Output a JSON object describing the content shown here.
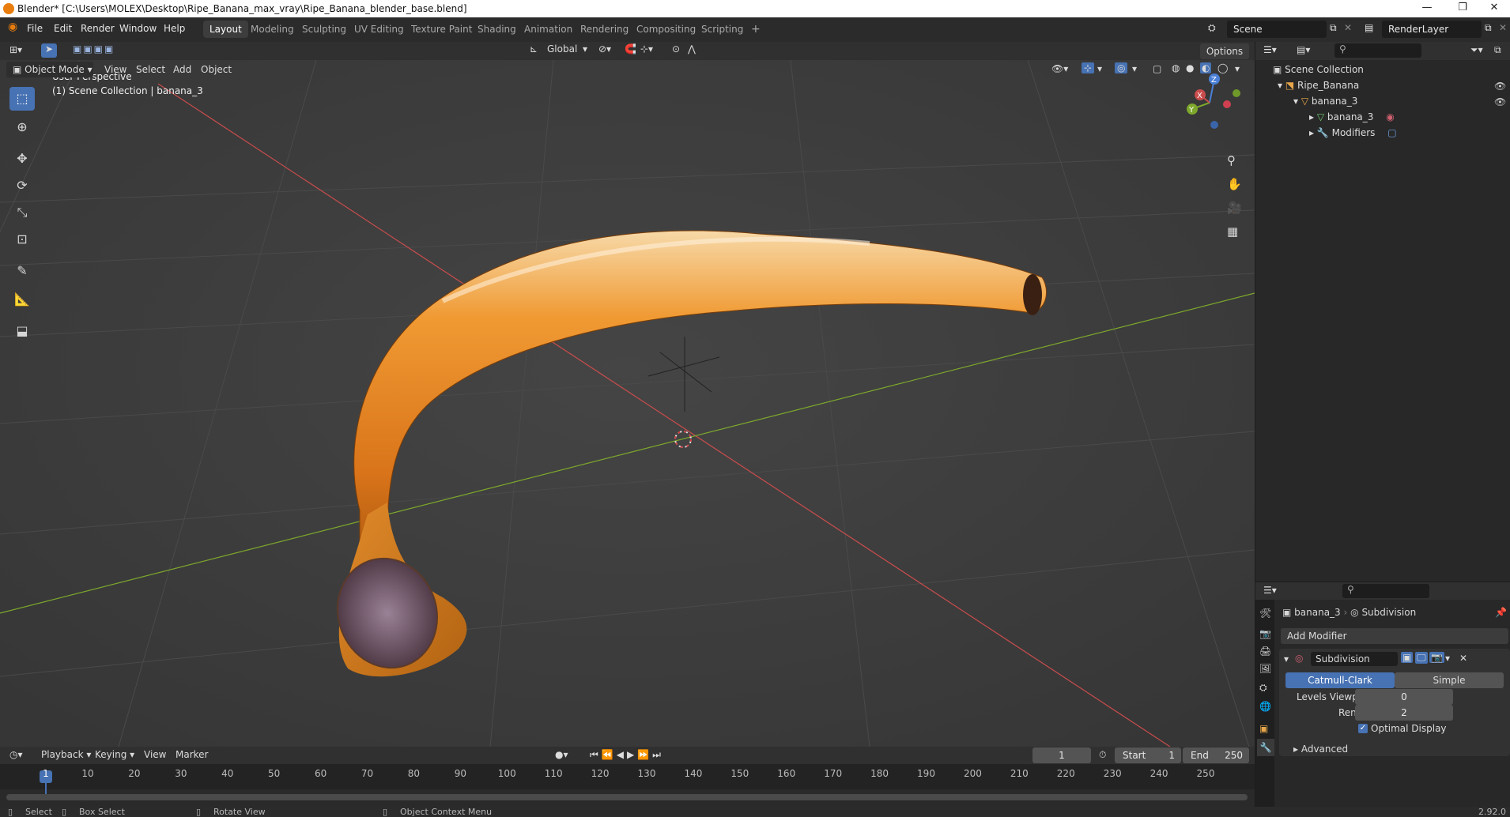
{
  "window": {
    "title": "Blender* [C:\\Users\\MOLEX\\Desktop\\Ripe_Banana_max_vray\\Ripe_Banana_blender_base.blend]",
    "minimize": "—",
    "maximize": "❐",
    "close": "✕"
  },
  "menu": [
    "File",
    "Edit",
    "Render",
    "Window",
    "Help"
  ],
  "workspaces": [
    "Layout",
    "Modeling",
    "Sculpting",
    "UV Editing",
    "Texture Paint",
    "Shading",
    "Animation",
    "Rendering",
    "Compositing",
    "Scripting"
  ],
  "workspace_add": "+",
  "scene": {
    "name": "Scene",
    "render_layer": "RenderLayer"
  },
  "view_header": {
    "transform_orientation": "Global",
    "options": "Options",
    "mode": "Object Mode",
    "menus": [
      "View",
      "Select",
      "Add",
      "Object"
    ]
  },
  "viewport": {
    "perspective": "User Perspective",
    "collection_info": "(1) Scene Collection | banana_3",
    "gizmo_labels": {
      "z": "Z",
      "y": "Y",
      "x": "X"
    }
  },
  "outliner": {
    "root": "Scene Collection",
    "items": [
      {
        "label": "Ripe_Banana",
        "depth": 1,
        "expanded": true
      },
      {
        "label": "banana_3",
        "depth": 2,
        "expanded": true
      },
      {
        "label": "banana_3",
        "depth": 3,
        "expanded": false
      },
      {
        "label": "Modifiers",
        "depth": 3,
        "expanded": false
      }
    ]
  },
  "properties": {
    "breadcrumb_object": "banana_3",
    "breadcrumb_modifier": "Subdivision",
    "add_modifier": "Add Modifier",
    "modifier_name": "Subdivision",
    "algorithms": [
      "Catmull-Clark",
      "Simple"
    ],
    "active_algorithm": "Catmull-Clark",
    "levels_viewport_label": "Levels Viewport",
    "levels_viewport": "0",
    "render_label": "Render",
    "render_value": "2",
    "optimal_display_label": "Optimal Display",
    "optimal_display": true,
    "advanced": "Advanced"
  },
  "timeline": {
    "menus": [
      "Playback",
      "Keying",
      "View",
      "Marker"
    ],
    "current_frame": "1",
    "start_label": "Start",
    "start": "1",
    "end_label": "End",
    "end": "250",
    "ticks": [
      "1",
      "10",
      "20",
      "30",
      "40",
      "50",
      "60",
      "70",
      "80",
      "90",
      "100",
      "110",
      "120",
      "130",
      "140",
      "150",
      "160",
      "170",
      "180",
      "190",
      "200",
      "210",
      "220",
      "230",
      "240",
      "250"
    ]
  },
  "statusbar": {
    "select": "Select",
    "box_select": "Box Select",
    "rotate_view": "Rotate View",
    "context_menu": "Object Context Menu",
    "version": "2.92.0"
  },
  "colors": {
    "accent": "#4772b3",
    "banana": "#e68a1f",
    "x_axis": "#c84c4c",
    "y_axis": "#7da82c",
    "z_axis": "#4a7fd6"
  }
}
